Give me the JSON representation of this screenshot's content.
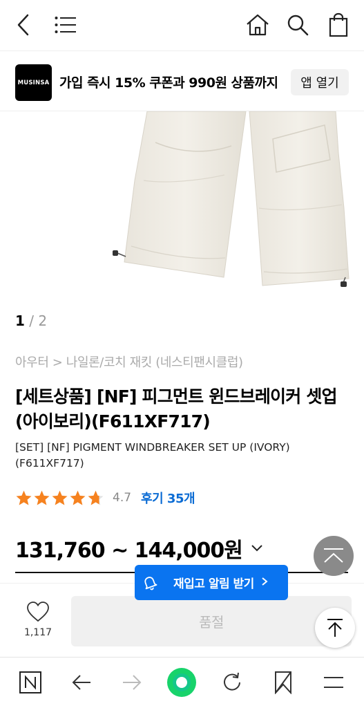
{
  "topbar": {
    "icons": [
      "back-icon",
      "menu-icon",
      "home-icon",
      "search-icon",
      "shopping-bag-icon"
    ]
  },
  "banner": {
    "logo_text": "MUSINSA",
    "promo_text": "가입 즉시 15% 쿠폰과 990원 상품까지",
    "open_app_label": "앱 열기"
  },
  "gallery": {
    "current": "1",
    "separator": "/",
    "total": "2"
  },
  "product": {
    "breadcrumb": "아우터 > 나일론/코치 재킷 (네스티팬시클럽)",
    "title": "[세트상품] [NF] 피그먼트 윈드브레이커 셋업 (아이보리)(F611XF717)",
    "subtitle": "[SET] [NF] PIGMENT WINDBREAKER SET UP (IVORY) (F611XF717)",
    "rating": 4.7,
    "rating_text": "4.7",
    "reviews_label": "후기 35개",
    "price": "131,760 ~ 144,000원"
  },
  "actions": {
    "like_count": "1,117",
    "soldout_label": "품절",
    "restock_label": "재입고 알림 받기"
  },
  "browser_bar": {
    "icons": [
      "naver-n-icon",
      "back-arrow-icon",
      "forward-arrow-icon",
      "green-dot-icon",
      "refresh-icon",
      "bookmark-icon",
      "menu-icon"
    ]
  },
  "colors": {
    "star": "#f6821f",
    "review_link": "#0c6cd4",
    "restock_bg": "#0a74f0",
    "green_dot": "#18d36b",
    "logo_bg": "#000000"
  }
}
